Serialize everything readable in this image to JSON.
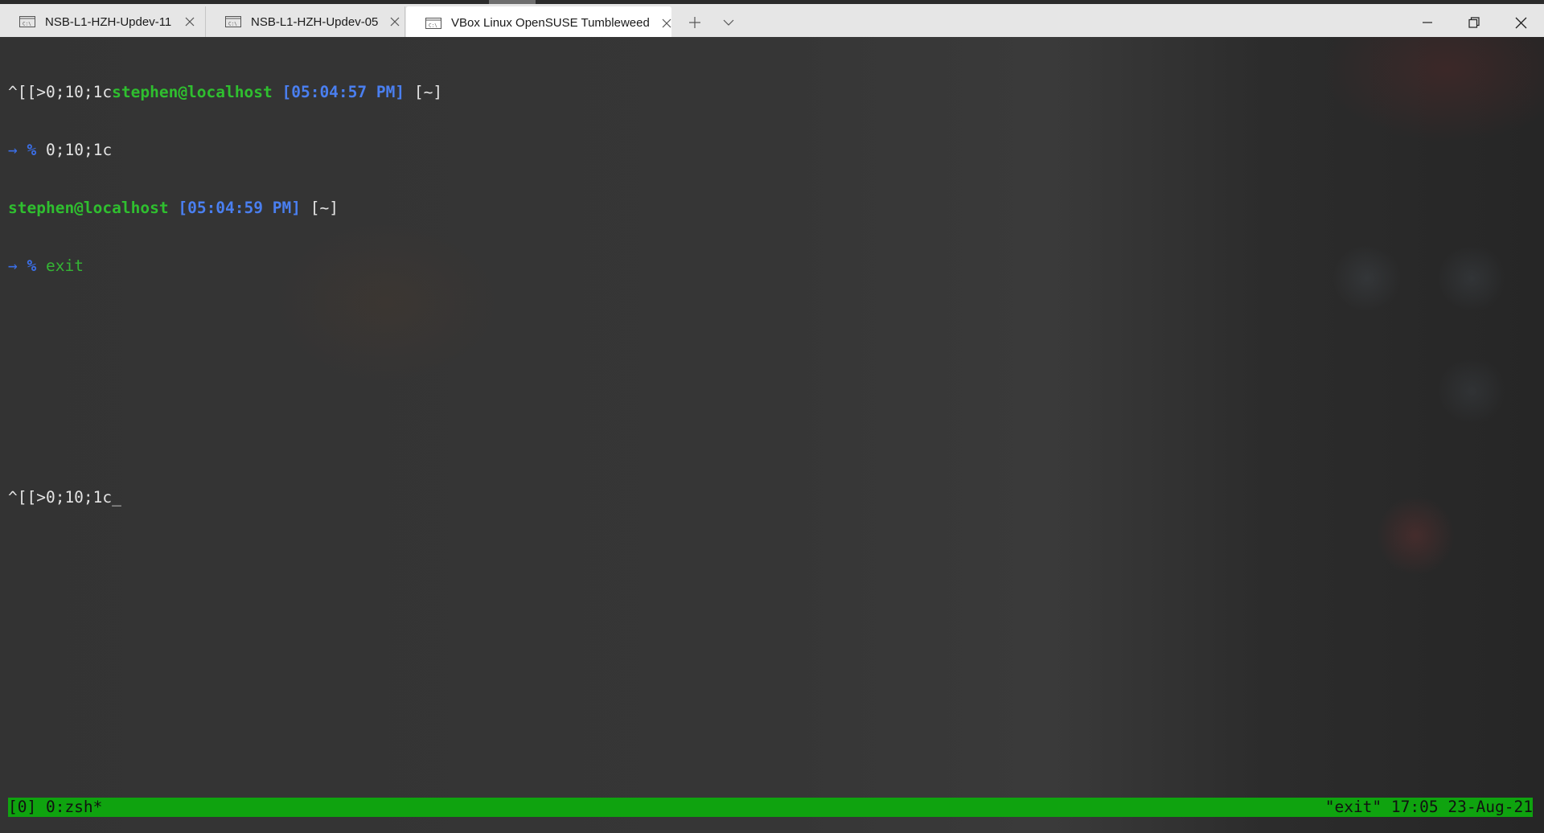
{
  "tabs": [
    {
      "label": "NSB-L1-HZH-Updev-11",
      "icon": "console-icon",
      "active": false
    },
    {
      "label": "NSB-L1-HZH-Updev-05",
      "icon": "console-icon",
      "active": false
    },
    {
      "label": "VBox Linux OpenSUSE Tumbleweed",
      "icon": "console-icon",
      "active": true
    }
  ],
  "titlebar_icons": {
    "new_tab": "plus-icon",
    "dropdown": "chevron-down-icon",
    "minimize": "minimize-icon",
    "restore": "restore-icon",
    "close": "close-icon"
  },
  "terminal": {
    "line1": {
      "escape": "^[[>0;10;1c",
      "user_host": "stephen@localhost",
      "time": "[05:04:57 PM]",
      "dir": "[~]"
    },
    "line2": {
      "arrow": "→",
      "pct": "%",
      "command": "0;10;1c"
    },
    "line3": {
      "user_host": "stephen@localhost",
      "time": "[05:04:59 PM]",
      "dir": "[~]"
    },
    "line4": {
      "arrow": "→",
      "pct": "%",
      "command": "exit"
    },
    "line8": {
      "text": "^[[>0;10;1c",
      "cursor": "_"
    }
  },
  "status_bar": {
    "left": "[0] 0:zsh*",
    "right": "\"exit\" 17:05 23-Aug-21"
  },
  "colors": {
    "terminal_bg": "#333333",
    "prompt_green": "#2fbf2f",
    "prompt_blue": "#4a7ff0",
    "status_green": "#0fa30f",
    "titlebar_bg": "#e6e6e6"
  }
}
